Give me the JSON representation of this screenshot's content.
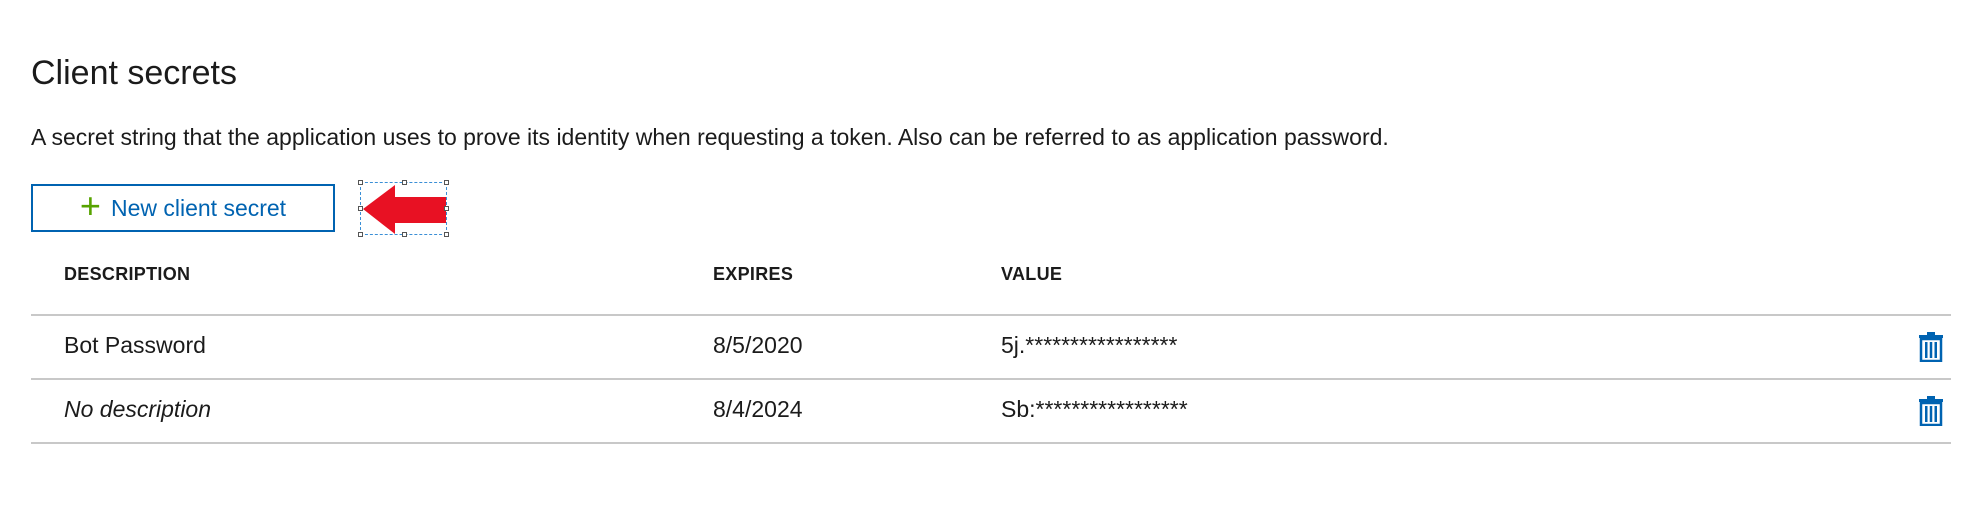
{
  "section": {
    "title": "Client secrets",
    "description": "A secret string that the application uses to prove its identity when requesting a token. Also can be referred to as application password."
  },
  "new_secret_button": {
    "icon": "plus-icon",
    "label": "New client secret",
    "icon_color": "#57a300",
    "text_color": "#0063b1"
  },
  "annotation": {
    "icon": "red-arrow-left-icon",
    "color": "#e81123"
  },
  "table": {
    "columns": [
      "DESCRIPTION",
      "EXPIRES",
      "VALUE"
    ],
    "rows": [
      {
        "description": "Bot Password",
        "expires": "8/5/2020",
        "value": "5j.*****************",
        "delete_icon": "trash-icon"
      },
      {
        "description": "No description",
        "expires": "8/4/2024",
        "value": "Sb:*****************",
        "delete_icon": "trash-icon"
      }
    ]
  }
}
